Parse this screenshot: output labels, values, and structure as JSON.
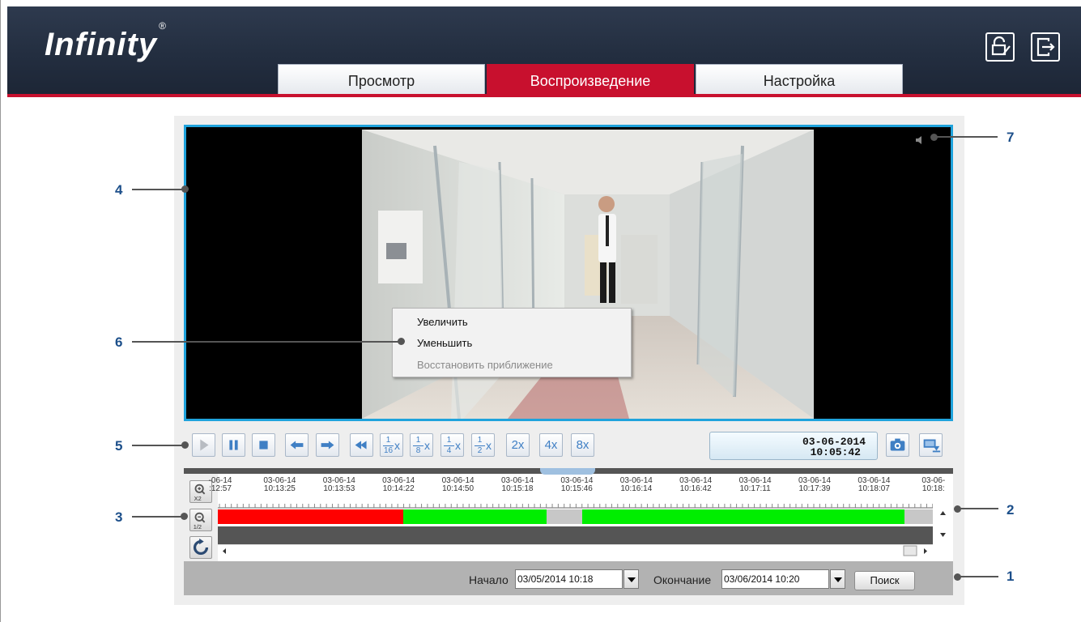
{
  "app": {
    "logo": "Infinity",
    "registered": "®"
  },
  "tabs": [
    {
      "label": "Просмотр",
      "active": false
    },
    {
      "label": "Воспроизведение",
      "active": true
    },
    {
      "label": "Настройка",
      "active": false
    }
  ],
  "header_icons": [
    "lock-edit-icon",
    "logout-icon"
  ],
  "context_menu": {
    "items": [
      {
        "label": "Увеличить",
        "enabled": true
      },
      {
        "label": "Уменьшить",
        "enabled": true
      },
      {
        "label": "Восстановить приближение",
        "enabled": false
      }
    ]
  },
  "controls": {
    "icons": [
      "play-icon",
      "pause-icon",
      "stop-icon",
      "step-back-icon",
      "step-forward-icon",
      "rewind-icon"
    ],
    "speeds": [
      {
        "num": "1",
        "den": "16",
        "suffix": "x"
      },
      {
        "num": "1",
        "den": "8",
        "suffix": "x"
      },
      {
        "num": "1",
        "den": "4",
        "suffix": "x"
      },
      {
        "num": "1",
        "den": "2",
        "suffix": "x"
      }
    ],
    "speeds_whole": [
      "2x",
      "4x",
      "8x"
    ]
  },
  "datetime": {
    "date": "03-06-2014",
    "time": "10:05:42"
  },
  "timeline": {
    "zoom_in_label": "X2",
    "zoom_out_label": "1/2",
    "ticks": [
      {
        "date": "-06-14",
        "time": ":12:57"
      },
      {
        "date": "03-06-14",
        "time": "10:13:25"
      },
      {
        "date": "03-06-14",
        "time": "10:13:53"
      },
      {
        "date": "03-06-14",
        "time": "10:14:22"
      },
      {
        "date": "03-06-14",
        "time": "10:14:50"
      },
      {
        "date": "03-06-14",
        "time": "10:15:18"
      },
      {
        "date": "03-06-14",
        "time": "10:15:46"
      },
      {
        "date": "03-06-14",
        "time": "10:16:14"
      },
      {
        "date": "03-06-14",
        "time": "10:16:42"
      },
      {
        "date": "03-06-14",
        "time": "10:17:11"
      },
      {
        "date": "03-06-14",
        "time": "10:17:39"
      },
      {
        "date": "03-06-14",
        "time": "10:18:07"
      },
      {
        "date": "03-06-",
        "time": "10:18:"
      }
    ],
    "colors": {
      "alarm": "#ff0000",
      "continuous": "#00ee00",
      "empty": "#c7c7c7"
    }
  },
  "search": {
    "start_label": "Начало",
    "start_value": "03/05/2014  10:18",
    "end_label": "Окончание",
    "end_value": "03/06/2014  10:20",
    "button": "Поиск"
  },
  "callouts": [
    "1",
    "2",
    "3",
    "4",
    "5",
    "6",
    "7"
  ]
}
